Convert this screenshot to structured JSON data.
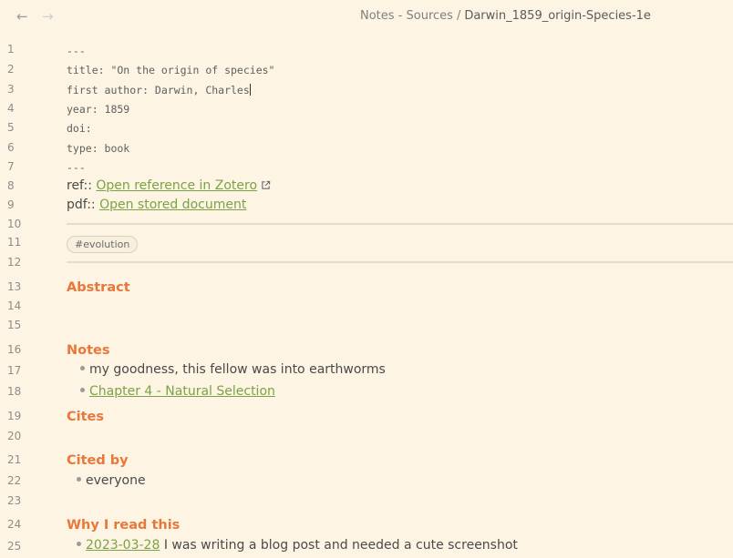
{
  "breadcrumb": {
    "folder": "Notes - Sources",
    "separator": "/",
    "current": "Darwin_1859_origin-Species-1e"
  },
  "line_numbers": [
    "1",
    "2",
    "3",
    "4",
    "5",
    "6",
    "7",
    "8",
    "9",
    "10",
    "11",
    "12",
    "13",
    "14",
    "15",
    "16",
    "17",
    "18",
    "19",
    "20",
    "21",
    "22",
    "23",
    "24",
    "25"
  ],
  "frontmatter": {
    "open_delim": "---",
    "title_line": "title: \"On the origin of species\"",
    "author_line": "first author: Darwin, Charles",
    "year_line": "year: 1859",
    "doi_line": "doi:",
    "type_line": "type: book",
    "close_delim": "---"
  },
  "props": {
    "ref_label": "ref::",
    "ref_link": "Open reference in Zotero",
    "pdf_label": "pdf::",
    "pdf_link": "Open stored document"
  },
  "tag": "#evolution",
  "sections": {
    "abstract": "Abstract",
    "notes": "Notes",
    "note_1": "my goodness, this fellow was into earthworms",
    "note_2_link": "Chapter 4 - Natural Selection",
    "cites": "Cites",
    "cited_by": "Cited by",
    "cited_by_1": "everyone",
    "why": "Why I read this",
    "why_date": "2023-03-28",
    "why_text": "I was writing a blog post and needed a cute screenshot"
  },
  "colors": {
    "background": "#fdf4e3",
    "heading": "#e8773a",
    "link": "#7aa345",
    "muted": "#8d8d8d"
  }
}
